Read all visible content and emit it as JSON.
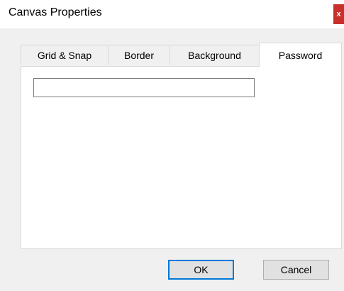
{
  "window": {
    "title": "Canvas Properties",
    "close_label": "x"
  },
  "tabs": [
    {
      "label": "Grid & Snap",
      "active": false
    },
    {
      "label": "Border",
      "active": false
    },
    {
      "label": "Background",
      "active": false
    },
    {
      "label": "Password",
      "active": true
    }
  ],
  "password_tab": {
    "password_value": ""
  },
  "buttons": {
    "ok_label": "OK",
    "cancel_label": "Cancel"
  },
  "colors": {
    "close_button": "#c9302c",
    "default_button_border": "#0078d7",
    "dialog_background": "#f0f0f0"
  }
}
